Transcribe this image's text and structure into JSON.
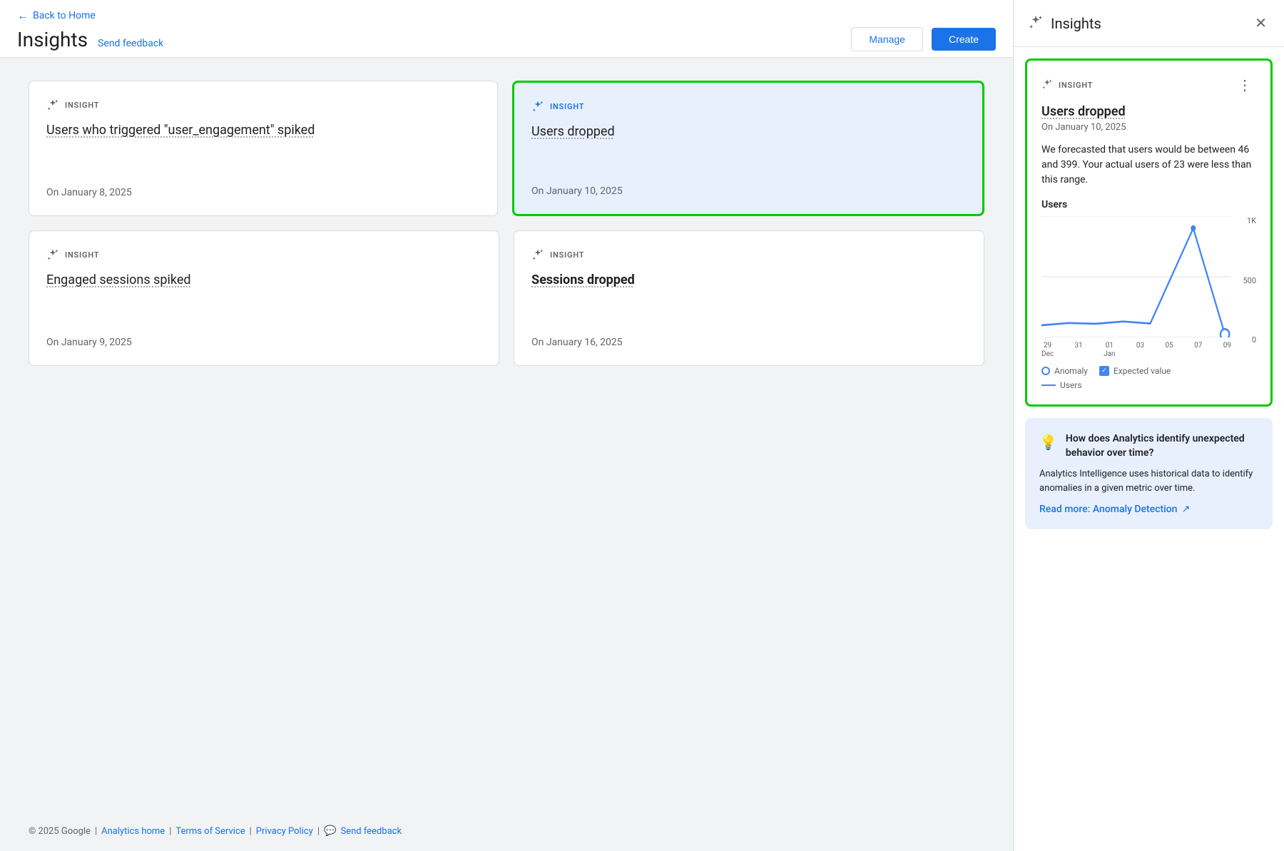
{
  "nav": {
    "back_label": "Back to Home",
    "back_arrow": "←"
  },
  "header": {
    "title": "Insights",
    "send_feedback_label": "Send feedback",
    "manage_label": "Manage",
    "create_label": "Create"
  },
  "cards": [
    {
      "id": "card-1",
      "label": "INSIGHT",
      "title": "Users who triggered \"user_engagement\" spiked",
      "date": "On January 8, 2025",
      "selected": false
    },
    {
      "id": "card-2",
      "label": "INSIGHT",
      "title": "Users dropped",
      "date": "On January 10, 2025",
      "selected": true
    },
    {
      "id": "card-3",
      "label": "INSIGHT",
      "title": "Engaged sessions spiked",
      "date": "On January 9, 2025",
      "selected": false
    },
    {
      "id": "card-4",
      "label": "INSIGHT",
      "title": "Sessions dropped",
      "date": "On January 16, 2025",
      "selected": false
    }
  ],
  "footer": {
    "copyright": "© 2025 Google",
    "analytics_home": "Analytics home",
    "terms": "Terms of Service",
    "privacy": "Privacy Policy",
    "send_feedback": "Send feedback"
  },
  "panel": {
    "title": "Insights",
    "insight": {
      "label": "INSIGHT",
      "title": "Users dropped",
      "date": "On January 10, 2025",
      "description": "We forecasted that users would be between 46 and 399. Your actual users of 23 were less than this range.",
      "chart_title": "Users",
      "y_labels": [
        "1K",
        "500",
        "0"
      ],
      "x_labels": [
        "29\nDec",
        "31",
        "01\nJan",
        "03",
        "05",
        "07",
        "09"
      ],
      "legend": [
        {
          "type": "circle",
          "label": "Anomaly"
        },
        {
          "type": "check",
          "label": "Expected value"
        },
        {
          "type": "line",
          "label": "Users"
        }
      ]
    },
    "info_card": {
      "title": "How does Analytics identify unexpected behavior over time?",
      "description": "Analytics Intelligence uses historical data to identify anomalies in a given metric over time.",
      "link_label": "Read more: Anomaly Detection"
    }
  }
}
